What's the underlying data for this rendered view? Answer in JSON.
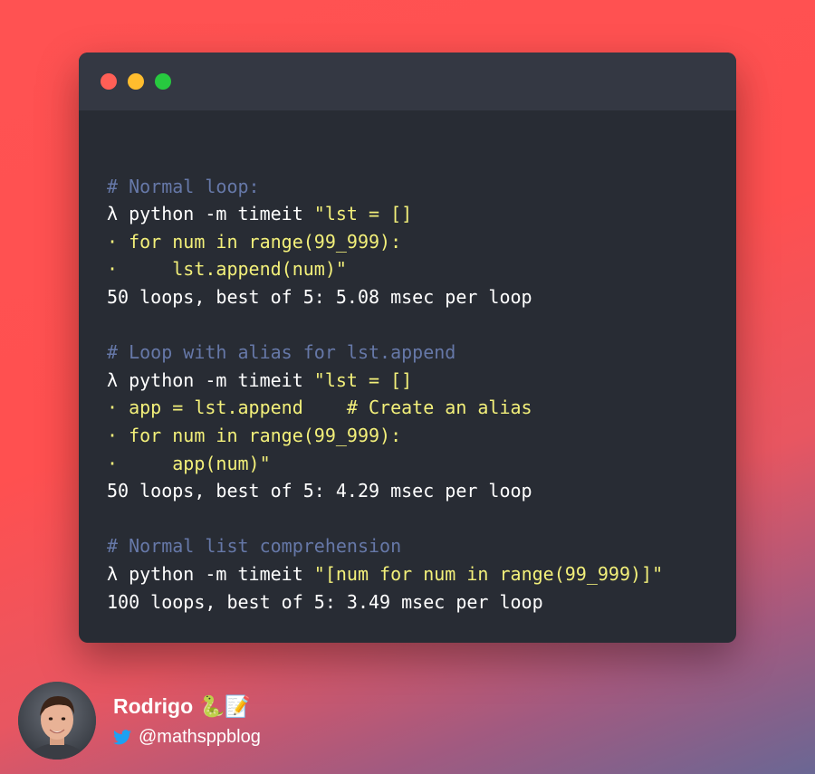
{
  "window": {
    "buttons": [
      "close",
      "minimize",
      "maximize"
    ]
  },
  "code_lines": [
    {
      "parts": []
    },
    {
      "parts": [
        {
          "cls": "comment",
          "text": "# Normal loop:"
        }
      ]
    },
    {
      "parts": [
        {
          "cls": "prompt",
          "text": "λ "
        },
        {
          "cls": "cmd",
          "text": "python -m timeit "
        },
        {
          "cls": "str",
          "text": "\"lst = []"
        }
      ]
    },
    {
      "parts": [
        {
          "cls": "cont",
          "text": "· for num in range(99_999):"
        }
      ]
    },
    {
      "parts": [
        {
          "cls": "cont",
          "text": "·     lst.append(num)\""
        }
      ]
    },
    {
      "parts": [
        {
          "cls": "output",
          "text": "50 loops, best of 5: 5.08 msec per loop"
        }
      ]
    },
    {
      "parts": []
    },
    {
      "parts": [
        {
          "cls": "comment",
          "text": "# Loop with alias for lst.append"
        }
      ]
    },
    {
      "parts": [
        {
          "cls": "prompt",
          "text": "λ "
        },
        {
          "cls": "cmd",
          "text": "python -m timeit "
        },
        {
          "cls": "str",
          "text": "\"lst = []"
        }
      ]
    },
    {
      "parts": [
        {
          "cls": "cont",
          "text": "· app = lst.append    # Create an alias"
        }
      ]
    },
    {
      "parts": [
        {
          "cls": "cont",
          "text": "· for num in range(99_999):"
        }
      ]
    },
    {
      "parts": [
        {
          "cls": "cont",
          "text": "·     app(num)\""
        }
      ]
    },
    {
      "parts": [
        {
          "cls": "output",
          "text": "50 loops, best of 5: 4.29 msec per loop"
        }
      ]
    },
    {
      "parts": []
    },
    {
      "parts": [
        {
          "cls": "comment",
          "text": "# Normal list comprehension"
        }
      ]
    },
    {
      "parts": [
        {
          "cls": "prompt",
          "text": "λ "
        },
        {
          "cls": "cmd",
          "text": "python -m timeit "
        },
        {
          "cls": "str",
          "text": "\"[num for num in range(99_999)]\""
        }
      ]
    },
    {
      "parts": [
        {
          "cls": "output",
          "text": "100 loops, best of 5: 3.49 msec per loop"
        }
      ]
    }
  ],
  "author": {
    "name": "Rodrigo 🐍📝",
    "handle": "@mathsppblog",
    "handle_icon": "twitter-bird-icon",
    "twitter_color": "#1da1f2"
  },
  "colors": {
    "background_top": "#ff5252",
    "background_bottom": "#6a6794",
    "window_bg": "#282c34",
    "titlebar_bg": "#343843",
    "comment": "#6678a8",
    "string": "#f3f07a"
  }
}
